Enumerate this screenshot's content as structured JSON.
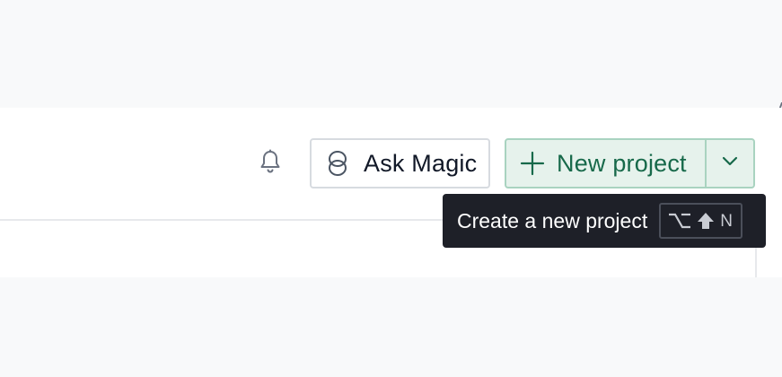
{
  "header": {
    "notifications": {
      "icon": "bell-icon"
    },
    "ask_magic": {
      "icon": "magic-rings-icon",
      "label": "Ask Magic"
    },
    "new_project": {
      "icon": "plus-icon",
      "label": "New project",
      "dropdown_icon": "chevron-down-icon"
    }
  },
  "tooltip": {
    "text": "Create a new project",
    "shortcut": {
      "keys": [
        "⌥",
        "⇧",
        "N"
      ],
      "key_icons": [
        "option-key-icon",
        "shift-key-icon",
        "n-key"
      ]
    }
  },
  "colors": {
    "accent": "#17694a",
    "accent_bg": "#e6f2ec",
    "accent_border": "#a9d3c0",
    "tooltip_bg": "#1e2028",
    "page_bg": "#f8f9fa"
  }
}
